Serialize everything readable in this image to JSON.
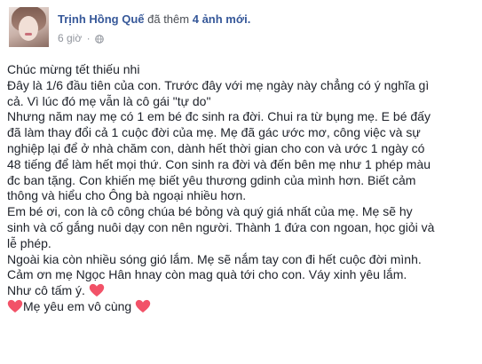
{
  "post": {
    "author": "Trịnh Hồng Quế",
    "action_prefix": "đã thêm",
    "action_count": "4 ảnh mới.",
    "timestamp": "6 giờ",
    "privacy_icon": "globe-icon",
    "lines": [
      "Chúc mừng tết thiếu nhi",
      "Đây là 1/6 đầu tiên của con. Trước đây với mẹ ngày này chẳng có ý nghĩa gì",
      "cả. Vì lúc đó mẹ vẫn là cô gái \"tự do\"",
      "Nhưng năm nay mẹ có 1 em bé đc sinh ra đời. Chui ra từ bụng mẹ. E bé đấy",
      "đã làm thay đổi cả 1 cuộc đời của mẹ. Mẹ đã gác ước mơ, công việc và sự",
      "nghiệp lại để ở nhà chăm con, dành hết thời gian cho con và ước 1 ngày có",
      "48 tiếng để làm hết mọi thứ. Con sinh ra đời và đến bên mẹ như 1 phép màu",
      "đc ban tặng. Con khiến mẹ biết yêu thương gdinh của mình hơn. Biết cảm",
      "thông và hiểu cho Ông bà ngoại nhiều hơn.",
      "Em bé ơi, con là cô công chúa bé bỏng và quý giá nhất của mẹ. Mẹ sẽ hy",
      "sinh và cố gắng nuôi dạy con nên người. Thành 1 đứa con ngoan, học giỏi và",
      "lễ phép.",
      "Ngoài kia còn nhiều sóng gió lắm. Mẹ sẽ nắm tay con đi hết cuộc đời mình.",
      "Cảm ơn mẹ Ngọc Hân hnay còn mag quà tới cho con. Váy xinh yêu lắm.",
      "Như cô tấm ý."
    ],
    "last_line": "Mẹ yêu em vô cùng",
    "heart_color": "#f25268"
  }
}
